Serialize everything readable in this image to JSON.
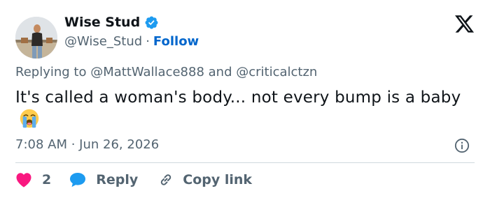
{
  "author": {
    "display_name": "Wise Stud",
    "handle": "@Wise_Stud",
    "separator": "·",
    "follow_label": "Follow"
  },
  "reply_context": {
    "prefix": "Replying to ",
    "mention_1": "@MattWallace888",
    "joiner": " and ",
    "mention_2": "@criticalctzn"
  },
  "tweet": {
    "text": "It's called a woman's body... not every bump is a baby"
  },
  "meta": {
    "time": "7:08 AM",
    "separator": " · ",
    "date": "Jun 26, 2026"
  },
  "actions": {
    "like_count": "2",
    "reply_label": "Reply",
    "copy_label": "Copy link"
  },
  "icons": {
    "logo": "x-logo-icon",
    "verified": "verified-badge-icon",
    "emoji": "loudly-crying-face-icon",
    "info": "info-icon",
    "like": "heart-icon",
    "reply": "speech-bubble-icon",
    "copy": "link-icon"
  },
  "colors": {
    "accent": "#1d9bf0",
    "follow_link": "#0066cc",
    "heart": "#f91880",
    "text": "#0f1419",
    "secondary_text": "#536471",
    "divider": "#cfd9de"
  }
}
